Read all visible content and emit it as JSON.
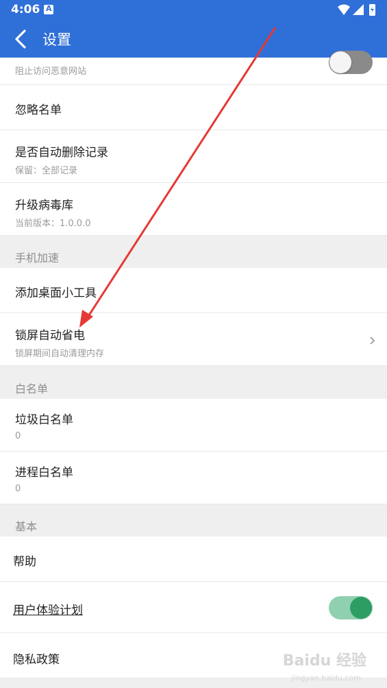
{
  "status_bar": {
    "time": "4:06",
    "icons": [
      "notification-a-icon",
      "wifi-icon",
      "signal-icon",
      "battery-charging-icon"
    ]
  },
  "app_bar": {
    "title": "设置",
    "back_icon": "back-arrow-icon"
  },
  "rows": {
    "block_malicious_sub": "阻止访问恶意网站",
    "ignore_list": "忽略名单",
    "auto_delete": {
      "title": "是否自动删除记录",
      "sub": "保留：全部记录"
    },
    "virus_db": {
      "title": "升级病毒库",
      "sub": "当前版本：1.0.0.0"
    },
    "widget": "添加桌面小工具",
    "lock_power": {
      "title": "锁屏自动省电",
      "sub": "锁屏期间自动清理内存"
    },
    "junk_whitelist": {
      "title": "垃圾白名单",
      "sub": "0"
    },
    "process_whitelist": {
      "title": "进程白名单",
      "sub": "0"
    },
    "help": "帮助",
    "user_experience": "用户体验计划",
    "privacy": "隐私政策"
  },
  "sections": {
    "phone_speedup": "手机加速",
    "whitelist": "白名单",
    "basic": "基本"
  },
  "toggles": {
    "block_malicious_on": false,
    "user_experience_on": true
  },
  "colors": {
    "accent": "#2f6fd8",
    "toggle_on_track": "#8fd0b0",
    "toggle_on_thumb": "#2e9d63",
    "toggle_off_track": "#8a8a8a",
    "toggle_off_thumb": "#f5f5f5",
    "annotation_arrow": "#e53935"
  },
  "watermark": {
    "main": "Baidu 经验",
    "sub": "jingyan.baidu.com"
  }
}
